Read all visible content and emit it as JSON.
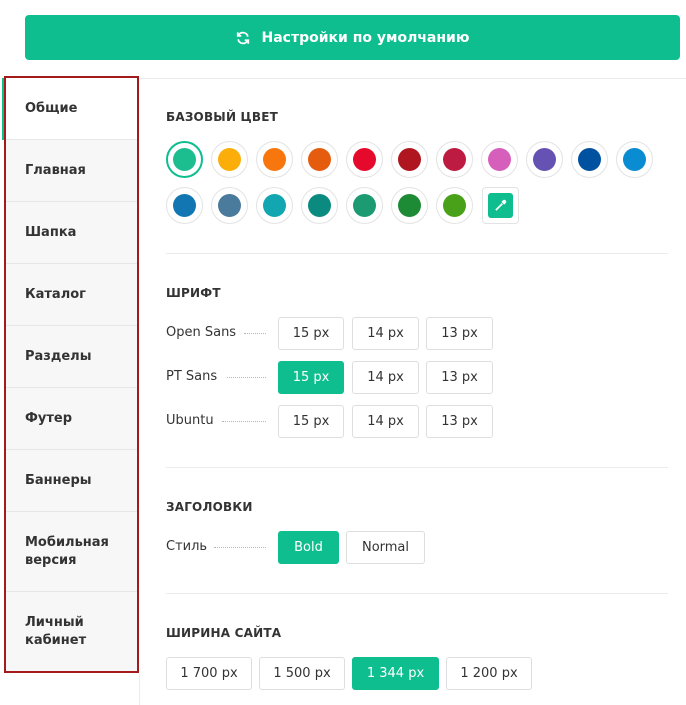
{
  "reset_button": {
    "label": "Настройки по умолчанию",
    "icon": "refresh-icon"
  },
  "accent_color": "#0fbe8f",
  "sidebar": {
    "items": [
      {
        "label": "Общие",
        "active": true
      },
      {
        "label": "Главная"
      },
      {
        "label": "Шапка"
      },
      {
        "label": "Каталог"
      },
      {
        "label": "Разделы"
      },
      {
        "label": "Футер"
      },
      {
        "label": "Баннеры"
      },
      {
        "label": "Мобильная\nверсия"
      },
      {
        "label": "Личный\nкабинет"
      }
    ]
  },
  "base_color": {
    "title": "БАЗОВЫЙ ЦВЕТ",
    "selected_index": 0,
    "colors": [
      "#1cbe8f",
      "#fbae0a",
      "#f7760e",
      "#e65c0f",
      "#e5092c",
      "#b0161f",
      "#be1b43",
      "#d65fbb",
      "#6652b2",
      "#0052a0",
      "#0a8cd3",
      "#1276b3",
      "#4a7a9c",
      "#12a6b0",
      "#0b8b80",
      "#1c9b72",
      "#1d8b36",
      "#49a11a"
    ],
    "picker_icon": "eyedropper-icon"
  },
  "font": {
    "title": "ШРИФТ",
    "rows": [
      {
        "name": "Open Sans",
        "sizes": [
          "15 px",
          "14 px",
          "13 px"
        ],
        "selected": -1
      },
      {
        "name": "PT Sans",
        "sizes": [
          "15 px",
          "14 px",
          "13 px"
        ],
        "selected": 0
      },
      {
        "name": "Ubuntu",
        "sizes": [
          "15 px",
          "14 px",
          "13 px"
        ],
        "selected": -1
      }
    ]
  },
  "headings": {
    "title": "ЗАГОЛОВКИ",
    "style_label": "Стиль",
    "options": [
      "Bold",
      "Normal"
    ],
    "selected": 0
  },
  "site_width": {
    "title": "ШИРИНА САЙТА",
    "options": [
      "1 700 px",
      "1 500 px",
      "1 344 px",
      "1 200 px"
    ],
    "selected": 2
  }
}
